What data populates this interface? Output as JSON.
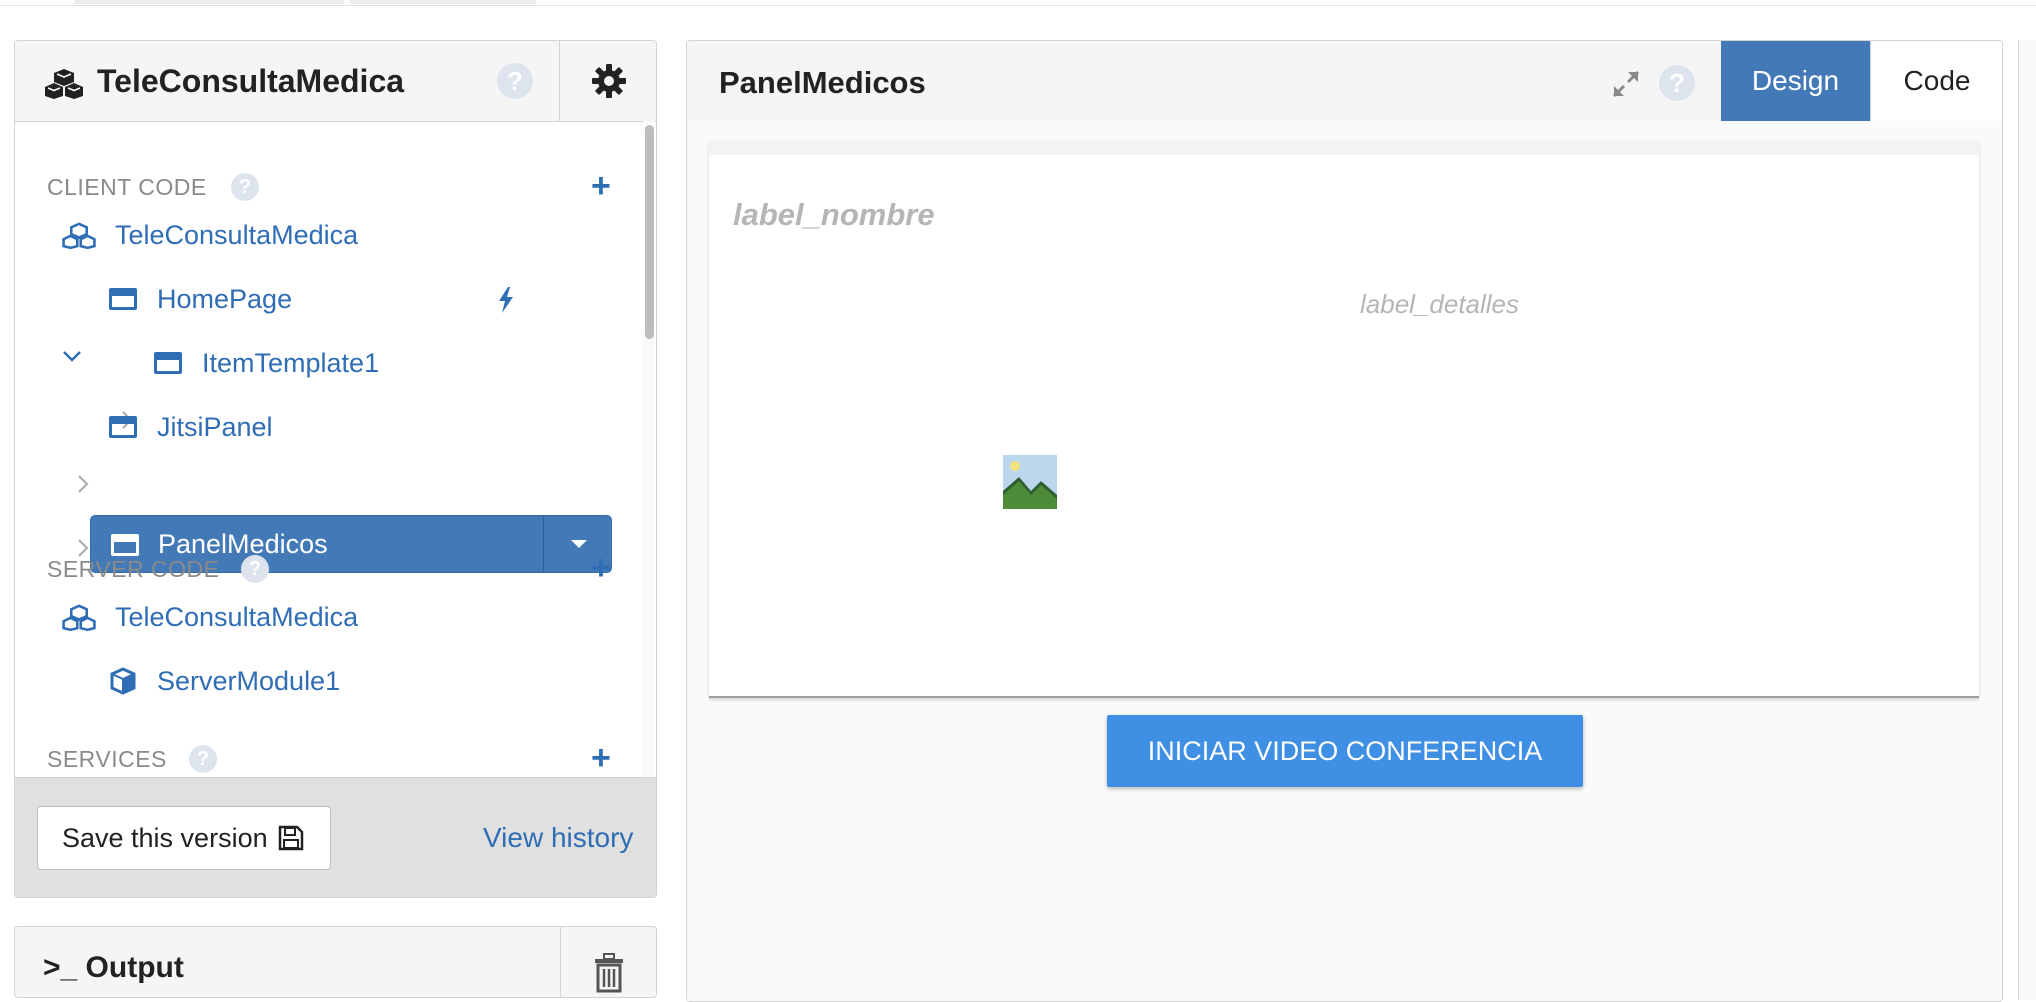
{
  "left_panel": {
    "app_title": "TeleConsultaMedica",
    "help_glyph": "?",
    "sections": {
      "client_code": {
        "title": "CLIENT CODE",
        "items": {
          "app": "TeleConsultaMedica",
          "homepage": "HomePage",
          "item_template": "ItemTemplate1",
          "jitsi_panel": "JitsiPanel",
          "panel_medicos": "PanelMedicos"
        }
      },
      "server_code": {
        "title": "SERVER CODE",
        "items": {
          "app": "TeleConsultaMedica",
          "server_module": "ServerModule1"
        }
      },
      "services": {
        "title": "SERVICES"
      }
    },
    "plus_glyph": "+",
    "footer": {
      "save_label": "Save this version",
      "history_label": "View history"
    }
  },
  "output": {
    "title": ">_ Output"
  },
  "editor": {
    "title": "PanelMedicos",
    "tabs": {
      "design": "Design",
      "code": "Code"
    },
    "form": {
      "label_nombre": "label_nombre",
      "label_detalles": "label_detalles",
      "button_label": "INICIAR VIDEO CONFERENCIA"
    }
  },
  "colors": {
    "accent": "#4379b6",
    "link": "#2f6db5",
    "button": "#3f8fe4"
  }
}
